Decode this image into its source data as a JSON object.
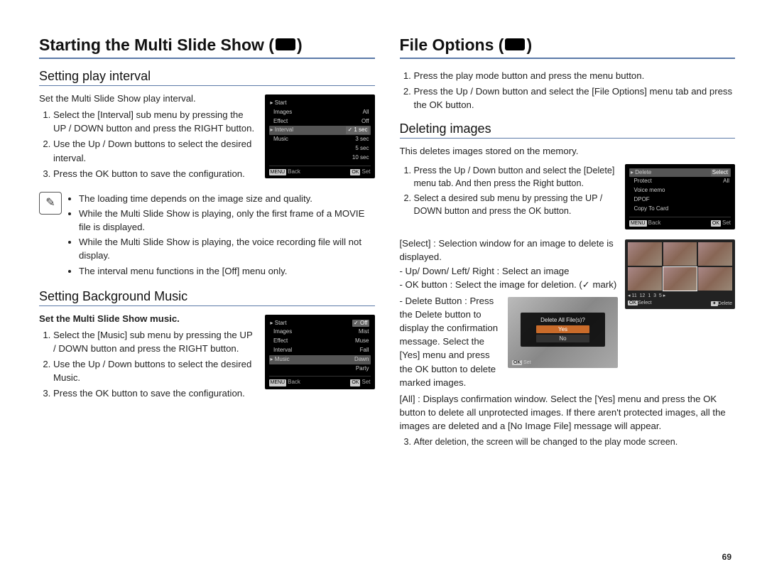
{
  "page_number": "69",
  "left": {
    "title_a": "Starting the Multi Slide Show (",
    "title_b": ")",
    "sec1": {
      "heading": "Setting play interval",
      "intro": "Set the Multi Slide Show play interval.",
      "steps": [
        "Select the [Interval] sub menu by pressing the UP / DOWN button and press the RIGHT button.",
        "Use the Up / Down buttons to select the desired interval.",
        "Press the OK button to save the configuration."
      ],
      "lcd": {
        "menu": [
          "Start",
          "Images",
          "Effect",
          "Interval",
          "Music"
        ],
        "right": [
          "",
          "All",
          "Off",
          "1 sec",
          ""
        ],
        "opts": [
          "1 sec",
          "3 sec",
          "5 sec",
          "10 sec"
        ],
        "back": "Back",
        "set": "Set",
        "kmenu": "MENU",
        "kok": "OK"
      },
      "notes": [
        "The loading time depends on the image size and quality.",
        "While the Multi Slide Show is playing, only the first frame of a MOVIE file is displayed.",
        "While the Multi Slide Show is playing, the voice recording file will not display.",
        "The interval menu functions in the [Off] menu only."
      ]
    },
    "sec2": {
      "heading": "Setting Background Music",
      "intro": "Set the Multi Slide Show music.",
      "steps": [
        "Select the [Music] sub menu by pressing the UP / DOWN button and press the RIGHT button.",
        "Use the Up / Down buttons to select the desired Music.",
        "Press the OK button to save the configuration."
      ],
      "lcd": {
        "menu": [
          "Start",
          "Images",
          "Effect",
          "Interval",
          "Music"
        ],
        "opts": [
          "Off",
          "Mist",
          "Muse",
          "Fall",
          "Dawn",
          "Party"
        ],
        "back": "Back",
        "set": "Set",
        "kmenu": "MENU",
        "kok": "OK"
      }
    }
  },
  "right": {
    "title_a": "File Options (",
    "title_b": ")",
    "intro_steps": [
      "Press the play mode button and press the menu button.",
      "Press the Up / Down button and select the [File Options] menu tab and press the OK button."
    ],
    "sec1": {
      "heading": "Deleting images",
      "intro": "This deletes images stored on the memory.",
      "s1": "Press the Up / Down button and select the [Delete] menu tab. And then press the Right button.",
      "s2a": "Select a desired sub menu by pressing the UP / DOWN button and press the OK button.",
      "s2_select_label": "[Select] : Selection window for an image to delete is displayed.",
      "s2_updown": "- Up/ Down/ Left/ Right : Select an image",
      "s2_ok_a": "- OK button : Select the image for deletion. (",
      "s2_ok_b": " mark)",
      "s2_delbtn": "- Delete Button : Press the Delete button to display the confirmation message. Select the [Yes] menu and press the OK button to delete marked images.",
      "s2_all": "[All] : Displays confirmation window. Select the [Yes] menu and press the OK button to delete all unprotected images. If there aren't protected images, all the images are deleted and a [No Image File] message will appear.",
      "s3": "After deletion, the screen will be changed to the play mode screen.",
      "lcd1": {
        "menu": [
          "Delete",
          "Protect",
          "Voice memo",
          "DPOF",
          "Copy To Card"
        ],
        "opts": [
          "Select",
          "All"
        ],
        "back": "Back",
        "set": "Set",
        "kmenu": "MENU",
        "kok": "OK"
      },
      "thumbs": {
        "select": "Select",
        "delete": "Delete",
        "kok": "OK",
        "kdel": "❚❚",
        "nums": [
          "11",
          "12",
          "1",
          "3",
          "5"
        ]
      },
      "dlg": {
        "q": "Delete All File(s)?",
        "yes": "Yes",
        "no": "No",
        "set": "Set",
        "kok": "OK"
      }
    }
  }
}
